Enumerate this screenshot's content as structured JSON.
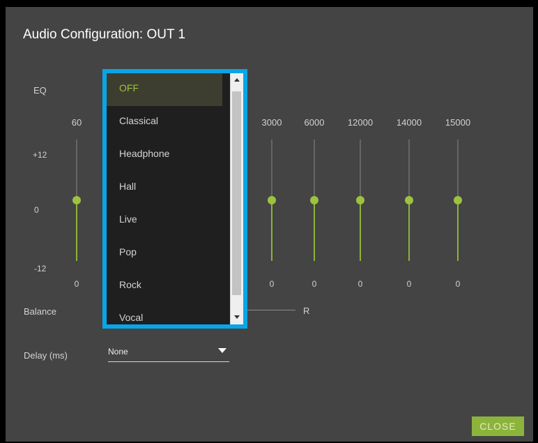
{
  "dialog": {
    "title": "Audio Configuration: OUT 1",
    "close_label": "CLOSE"
  },
  "eq": {
    "label": "EQ",
    "scale": {
      "top": "+12",
      "mid": "0",
      "bottom": "-12"
    },
    "bands": [
      {
        "freq": "60",
        "gain": "0",
        "level": 0
      },
      {
        "freq": "3000",
        "gain": "0",
        "level": 0
      },
      {
        "freq": "6000",
        "gain": "0",
        "level": 0
      },
      {
        "freq": "12000",
        "gain": "0",
        "level": 0
      },
      {
        "freq": "14000",
        "gain": "0",
        "level": 0
      },
      {
        "freq": "15000",
        "gain": "0",
        "level": 0
      }
    ],
    "hidden_band_fragment": "0",
    "preset_options": [
      "OFF",
      "Classical",
      "Headphone",
      "Hall",
      "Live",
      "Pop",
      "Rock",
      "Vocal"
    ],
    "selected_preset": "OFF"
  },
  "balance": {
    "label": "Balance",
    "right_label": "R"
  },
  "delay": {
    "label": "Delay (ms)",
    "value": "None"
  },
  "colors": {
    "accent_green": "#8cb43c",
    "dropdown_border": "#0aa5e8",
    "dialog_bg": "#444444"
  },
  "icons": {
    "delay_dropdown": "caret-down-icon",
    "scroll_up": "scroll-up-arrow-icon",
    "scroll_down": "scroll-down-arrow-icon"
  }
}
